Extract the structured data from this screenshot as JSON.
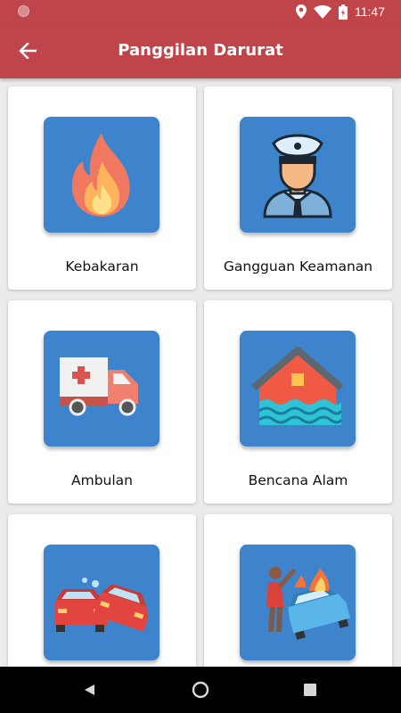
{
  "status_bar": {
    "time": "11:47",
    "icons": [
      "notification-dot",
      "location-icon",
      "wifi-icon",
      "battery-icon"
    ]
  },
  "app_bar": {
    "title": "Panggilan Darurat",
    "back_icon": "arrow-left-icon"
  },
  "colors": {
    "primary": "#c0454a",
    "tile_blue": "#3d84cc",
    "background": "#ebebeb"
  },
  "emergency_items": [
    {
      "label": "Kebakaran",
      "icon": "fire-icon"
    },
    {
      "label": "Gangguan Keamanan",
      "icon": "police-officer-icon"
    },
    {
      "label": "Ambulan",
      "icon": "ambulance-icon"
    },
    {
      "label": "Bencana Alam",
      "icon": "flood-house-icon"
    },
    {
      "label": "",
      "icon": "car-collision-icon"
    },
    {
      "label": "",
      "icon": "car-fire-accident-icon"
    }
  ],
  "nav_bar": {
    "buttons": [
      "back-triangle-icon",
      "home-circle-icon",
      "recents-square-icon"
    ]
  }
}
